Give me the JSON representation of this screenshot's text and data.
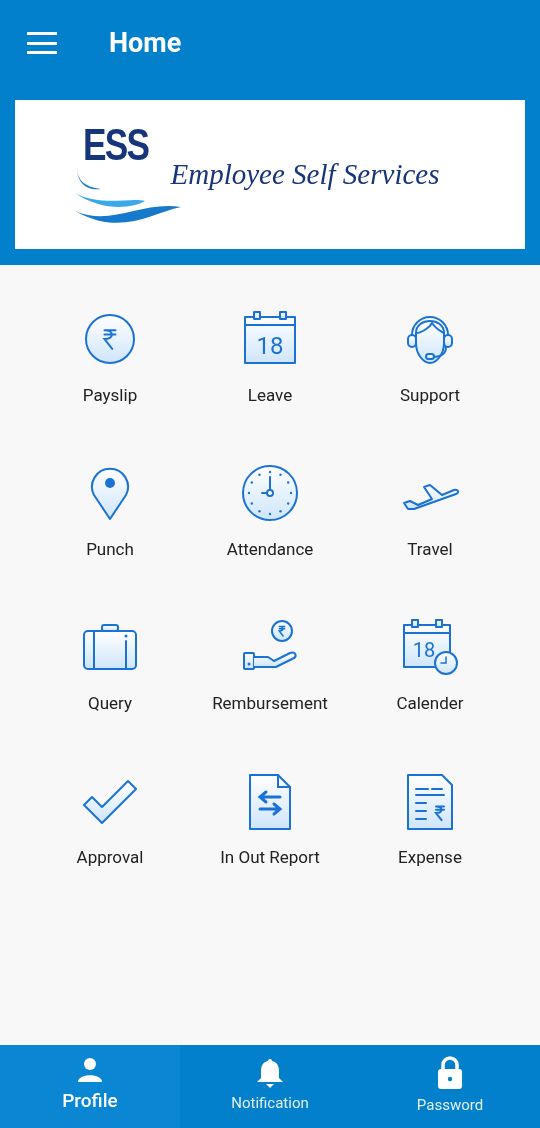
{
  "app_bar": {
    "title": "Home"
  },
  "banner": {
    "logo_mark": "ESS",
    "logo_text": "Employee Self Services"
  },
  "menu": [
    {
      "kind": "rupee-coin",
      "label": "Payslip"
    },
    {
      "kind": "calendar",
      "label": "Leave",
      "icon_text": "18"
    },
    {
      "kind": "headset",
      "label": "Support"
    },
    {
      "kind": "pin",
      "label": "Punch"
    },
    {
      "kind": "clock",
      "label": "Attendance"
    },
    {
      "kind": "plane",
      "label": "Travel"
    },
    {
      "kind": "briefcase",
      "label": "Query"
    },
    {
      "kind": "hand-coin",
      "label": "Rembursement"
    },
    {
      "kind": "calendar-clock",
      "label": "Calender",
      "icon_text": "18"
    },
    {
      "kind": "check",
      "label": "Approval"
    },
    {
      "kind": "doc-arrows",
      "label": "In Out Report"
    },
    {
      "kind": "doc-rupee",
      "label": "Expense"
    }
  ],
  "bottom_nav": [
    {
      "kind": "person",
      "label": "Profile",
      "selected": true
    },
    {
      "kind": "bell",
      "label": "Notification",
      "selected": false
    },
    {
      "kind": "lock",
      "label": "Password",
      "selected": false
    }
  ]
}
